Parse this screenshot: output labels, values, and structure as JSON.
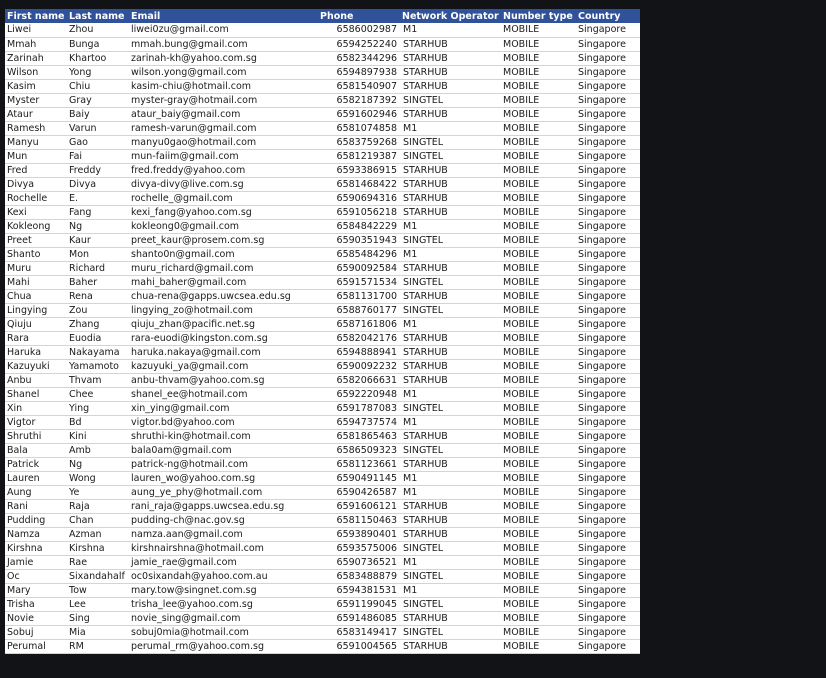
{
  "table": {
    "headers": [
      "First name",
      "Last name",
      "Email",
      "Phone",
      "Network Operator",
      "Number type",
      "Country"
    ],
    "rows": [
      [
        "Liwei",
        "Zhou",
        "liwei0zu@gmail.com",
        "6586002987",
        "M1",
        "MOBILE",
        "Singapore"
      ],
      [
        "Mmah",
        "Bunga",
        "mmah.bung@gmail.com",
        "6594252240",
        "STARHUB",
        "MOBILE",
        "Singapore"
      ],
      [
        "Zarinah",
        "Khartoo",
        "zarinah-kh@yahoo.com.sg",
        "6582344296",
        "STARHUB",
        "MOBILE",
        "Singapore"
      ],
      [
        "Wilson",
        "Yong",
        "wilson.yong@gmail.com",
        "6594897938",
        "STARHUB",
        "MOBILE",
        "Singapore"
      ],
      [
        "Kasim",
        "Chiu",
        "kasim-chiu@hotmail.com",
        "6581540907",
        "STARHUB",
        "MOBILE",
        "Singapore"
      ],
      [
        "Myster",
        "Gray",
        "myster-gray@hotmail.com",
        "6582187392",
        "SINGTEL",
        "MOBILE",
        "Singapore"
      ],
      [
        "Ataur",
        "Baiy",
        "ataur_baiy@gmail.com",
        "6591602946",
        "STARHUB",
        "MOBILE",
        "Singapore"
      ],
      [
        "Ramesh",
        "Varun",
        "ramesh-varun@gmail.com",
        "6581074858",
        "M1",
        "MOBILE",
        "Singapore"
      ],
      [
        "Manyu",
        "Gao",
        "manyu0gao@hotmail.com",
        "6583759268",
        "SINGTEL",
        "MOBILE",
        "Singapore"
      ],
      [
        "Mun",
        "Fai",
        "mun-faiim@gmail.com",
        "6581219387",
        "SINGTEL",
        "MOBILE",
        "Singapore"
      ],
      [
        "Fred",
        "Freddy",
        "fred.freddy@yahoo.com",
        "6593386915",
        "STARHUB",
        "MOBILE",
        "Singapore"
      ],
      [
        "Divya",
        "Divya",
        "divya-divy@live.com.sg",
        "6581468422",
        "STARHUB",
        "MOBILE",
        "Singapore"
      ],
      [
        "Rochelle",
        "E.",
        "rochelle_@gmail.com",
        "6590694316",
        "STARHUB",
        "MOBILE",
        "Singapore"
      ],
      [
        "Kexi",
        "Fang",
        "kexi_fang@yahoo.com.sg",
        "6591056218",
        "STARHUB",
        "MOBILE",
        "Singapore"
      ],
      [
        "Kokleong",
        "Ng",
        "kokleong0@gmail.com",
        "6584842229",
        "M1",
        "MOBILE",
        "Singapore"
      ],
      [
        "Preet",
        "Kaur",
        "preet_kaur@prosem.com.sg",
        "6590351943",
        "SINGTEL",
        "MOBILE",
        "Singapore"
      ],
      [
        "Shanto",
        "Mon",
        "shanto0n@gmail.com",
        "6585484296",
        "M1",
        "MOBILE",
        "Singapore"
      ],
      [
        "Muru",
        "Richard",
        "muru_richard@gmail.com",
        "6590092584",
        "STARHUB",
        "MOBILE",
        "Singapore"
      ],
      [
        "Mahi",
        "Baher",
        "mahi_baher@gmail.com",
        "6591571534",
        "SINGTEL",
        "MOBILE",
        "Singapore"
      ],
      [
        "Chua",
        "Rena",
        "chua-rena@gapps.uwcsea.edu.sg",
        "6581131700",
        "STARHUB",
        "MOBILE",
        "Singapore"
      ],
      [
        "Lingying",
        "Zou",
        "lingying_zo@hotmail.com",
        "6588760177",
        "SINGTEL",
        "MOBILE",
        "Singapore"
      ],
      [
        "Qiuju",
        "Zhang",
        "qiuju_zhan@pacific.net.sg",
        "6587161806",
        "M1",
        "MOBILE",
        "Singapore"
      ],
      [
        "Rara",
        "Euodia",
        "rara-euodi@kingston.com.sg",
        "6582042176",
        "STARHUB",
        "MOBILE",
        "Singapore"
      ],
      [
        "Haruka",
        "Nakayama",
        "haruka.nakaya@gmail.com",
        "6594888941",
        "STARHUB",
        "MOBILE",
        "Singapore"
      ],
      [
        "Kazuyuki",
        "Yamamoto",
        "kazuyuki_ya@gmail.com",
        "6590092232",
        "STARHUB",
        "MOBILE",
        "Singapore"
      ],
      [
        "Anbu",
        "Thvam",
        "anbu-thvam@yahoo.com.sg",
        "6582066631",
        "STARHUB",
        "MOBILE",
        "Singapore"
      ],
      [
        "Shanel",
        "Chee",
        "shanel_ee@hotmail.com",
        "6592220948",
        "M1",
        "MOBILE",
        "Singapore"
      ],
      [
        "Xin",
        "Ying",
        "xin_ying@gmail.com",
        "6591787083",
        "SINGTEL",
        "MOBILE",
        "Singapore"
      ],
      [
        "Vigtor",
        "Bd",
        "vigtor.bd@yahoo.com",
        "6594737574",
        "M1",
        "MOBILE",
        "Singapore"
      ],
      [
        "Shruthi",
        "Kini",
        "shruthi-kin@hotmail.com",
        "6581865463",
        "STARHUB",
        "MOBILE",
        "Singapore"
      ],
      [
        "Bala",
        "Amb",
        "bala0am@gmail.com",
        "6586509323",
        "SINGTEL",
        "MOBILE",
        "Singapore"
      ],
      [
        "Patrick",
        "Ng",
        "patrick-ng@hotmail.com",
        "6581123661",
        "STARHUB",
        "MOBILE",
        "Singapore"
      ],
      [
        "Lauren",
        "Wong",
        "lauren_wo@yahoo.com.sg",
        "6590491145",
        "M1",
        "MOBILE",
        "Singapore"
      ],
      [
        "Aung",
        "Ye",
        "aung_ye_phy@hotmail.com",
        "6590426587",
        "M1",
        "MOBILE",
        "Singapore"
      ],
      [
        "Rani",
        "Raja",
        "rani_raja@gapps.uwcsea.edu.sg",
        "6591606121",
        "STARHUB",
        "MOBILE",
        "Singapore"
      ],
      [
        "Pudding",
        "Chan",
        "pudding-ch@nac.gov.sg",
        "6581150463",
        "STARHUB",
        "MOBILE",
        "Singapore"
      ],
      [
        "Namza",
        "Azman",
        "namza.aan@gmail.com",
        "6593890401",
        "STARHUB",
        "MOBILE",
        "Singapore"
      ],
      [
        "Kirshna",
        "Kirshna",
        "kirshnairshna@hotmail.com",
        "6593575006",
        "SINGTEL",
        "MOBILE",
        "Singapore"
      ],
      [
        "Jamie",
        "Rae",
        "jamie_rae@gmail.com",
        "6590736521",
        "M1",
        "MOBILE",
        "Singapore"
      ],
      [
        "Oc",
        "Sixandahalf",
        "oc0sixandah@yahoo.com.au",
        "6583488879",
        "SINGTEL",
        "MOBILE",
        "Singapore"
      ],
      [
        "Mary",
        "Tow",
        "mary.tow@singnet.com.sg",
        "6594381531",
        "M1",
        "MOBILE",
        "Singapore"
      ],
      [
        "Trisha",
        "Lee",
        "trisha_lee@yahoo.com.sg",
        "6591199045",
        "SINGTEL",
        "MOBILE",
        "Singapore"
      ],
      [
        "Novie",
        "Sing",
        "novie_sing@gmail.com",
        "6591486085",
        "STARHUB",
        "MOBILE",
        "Singapore"
      ],
      [
        "Sobuj",
        "Mia",
        "sobuj0mia@hotmail.com",
        "6583149417",
        "SINGTEL",
        "MOBILE",
        "Singapore"
      ],
      [
        "Perumal",
        "RM",
        "perumal_rm@yahoo.com.sg",
        "6591004565",
        "STARHUB",
        "MOBILE",
        "Singapore"
      ]
    ]
  }
}
